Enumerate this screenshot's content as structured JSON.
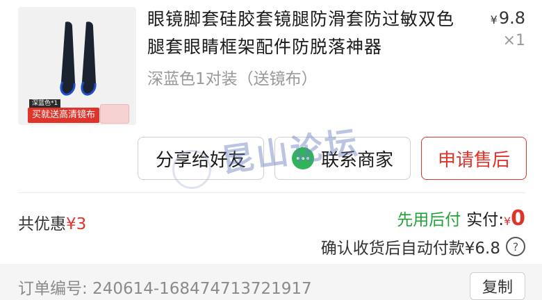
{
  "product": {
    "title": "眼镜脚套硅胶套镜腿防滑套防过敏双色腿套眼睛框架配件防脱落神器",
    "price_symbol": "¥",
    "price": "9.8",
    "quantity": "×1",
    "variant": "深蓝色1对装（送镜布）",
    "image_tag": "深蓝色*1",
    "image_promo": "买就送高清镜布"
  },
  "actions": {
    "share": "分享给好友",
    "contact": "联系商家",
    "after_sales": "申请售后"
  },
  "summary": {
    "discount_label": "共优惠",
    "discount_value": "¥3",
    "paylater_label": "先用后付",
    "paid_label": "实付:",
    "paid_symbol": "¥",
    "paid_value": "0",
    "autopay_text": "确认收货后自动付款¥6.8",
    "help_icon": "?"
  },
  "order": {
    "number_text": "订单编号: 240614-168474713721917",
    "copy_label": "复制"
  },
  "watermark": {
    "text": "昆山论坛"
  },
  "colors": {
    "accent_red": "#e0342b",
    "green": "#22a13a",
    "wechat_green": "#2fb457"
  }
}
